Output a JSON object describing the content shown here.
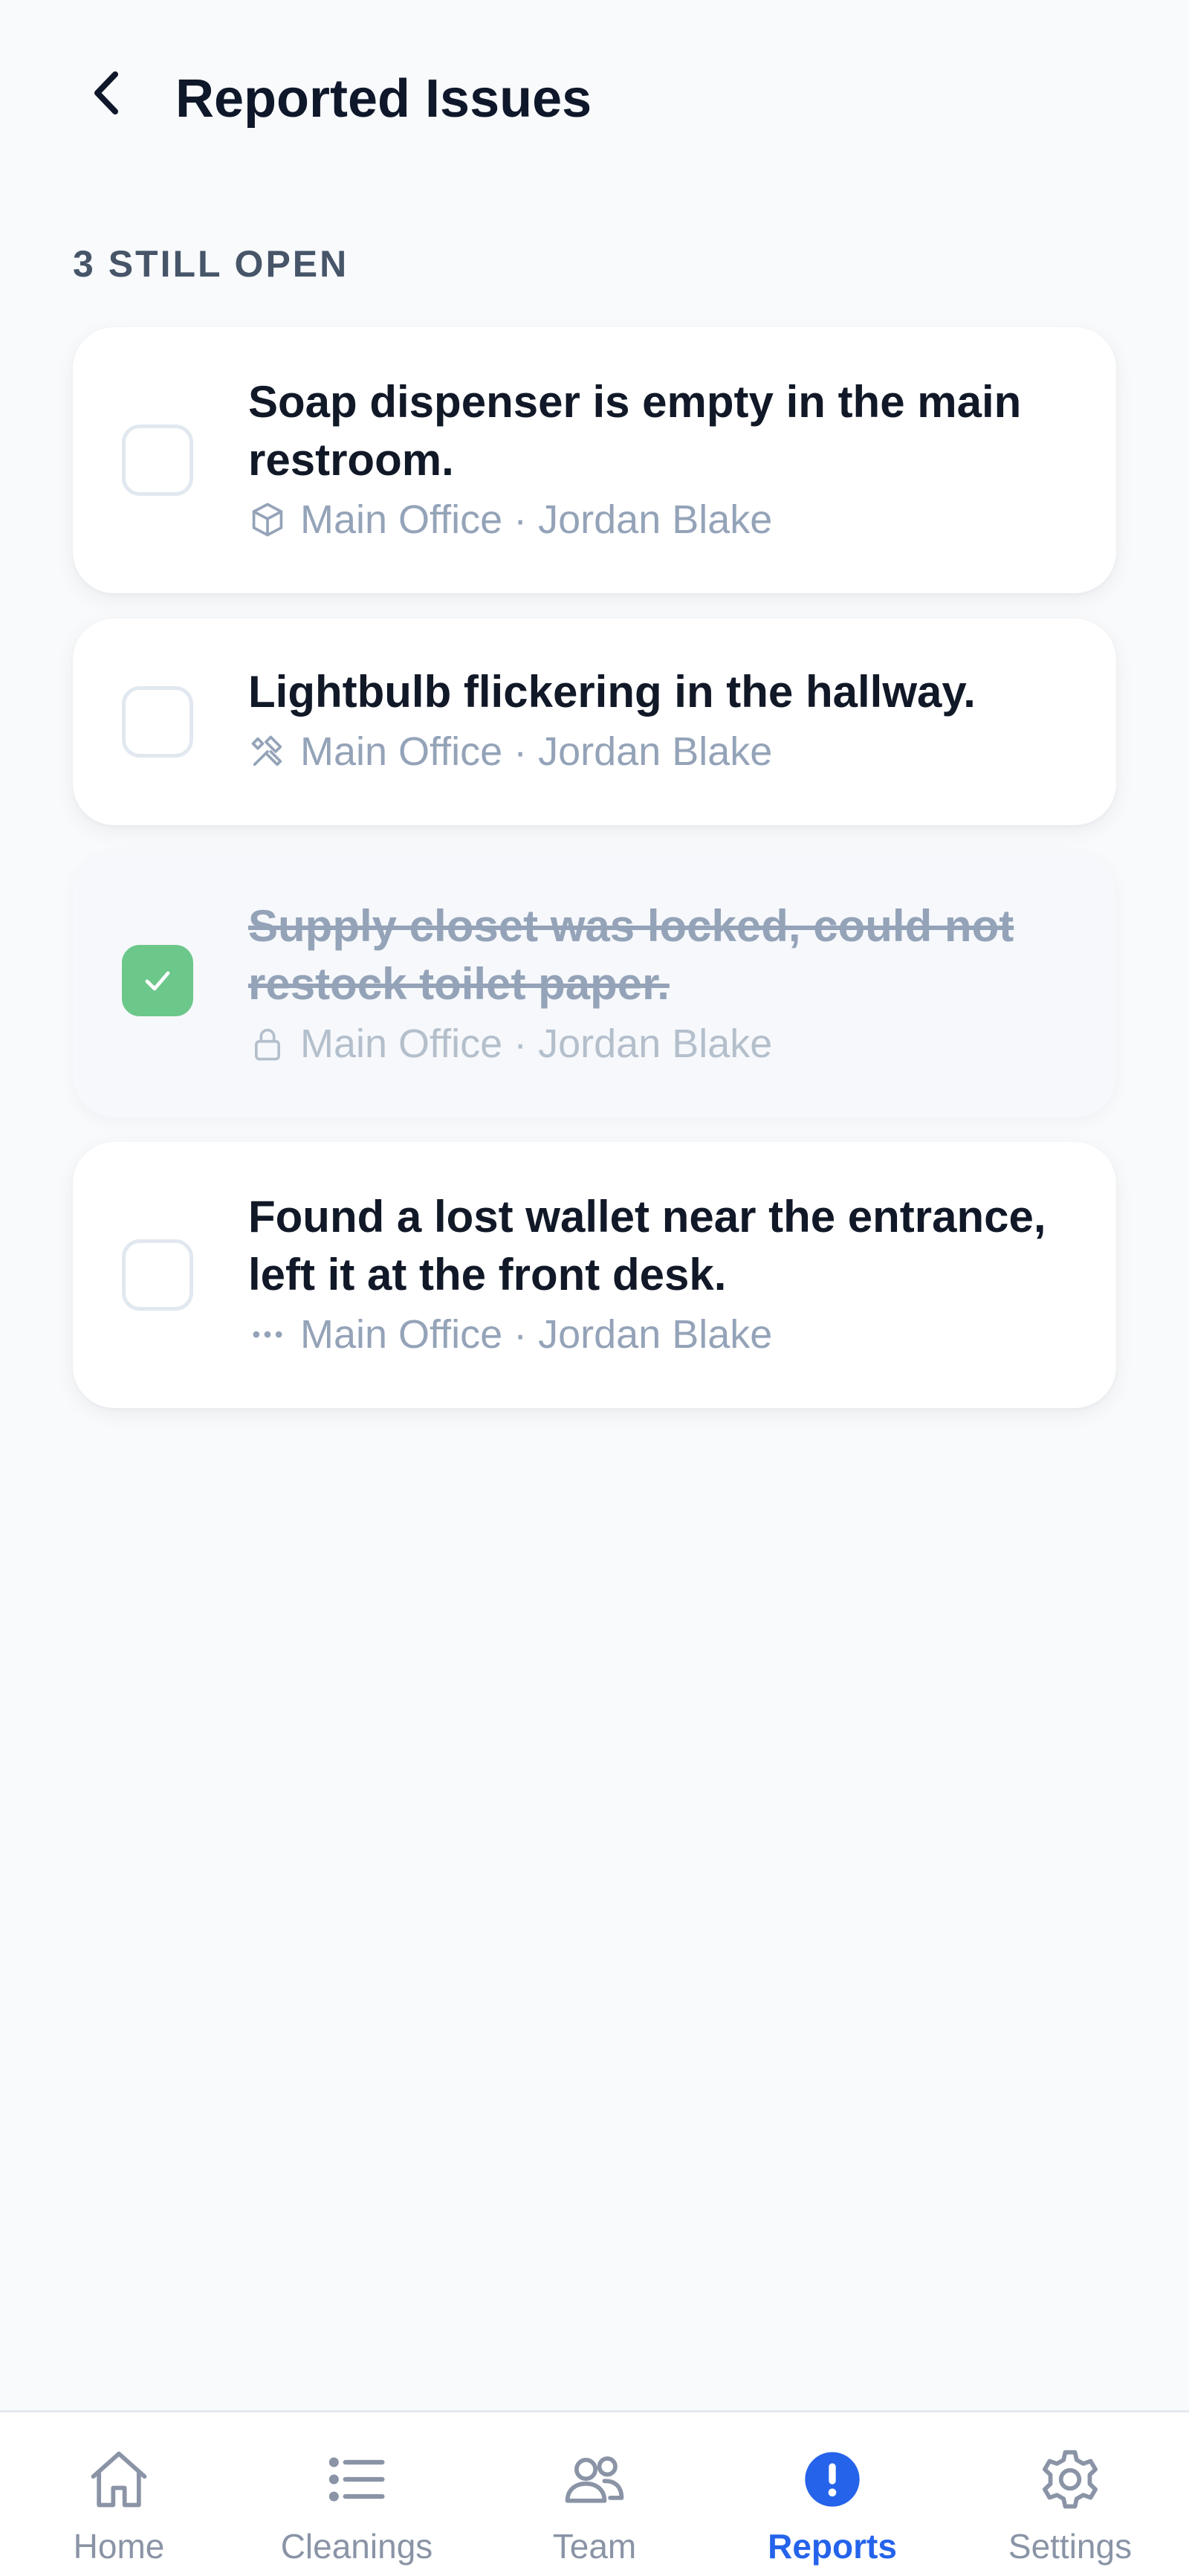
{
  "header": {
    "title": "Reported Issues"
  },
  "section": {
    "label": "3 Still Open"
  },
  "issues": [
    {
      "title": "Soap dispenser is empty in the main restroom.",
      "location": "Main Office",
      "reporter": "Jordan Blake",
      "separator": " · ",
      "category_icon": "box-icon",
      "resolved": false
    },
    {
      "title": "Lightbulb flickering in the hallway.",
      "location": "Main Office",
      "reporter": "Jordan Blake",
      "separator": " · ",
      "category_icon": "tools-icon",
      "resolved": false
    },
    {
      "title": "Supply closet was locked, could not restock toilet paper.",
      "location": "Main Office",
      "reporter": "Jordan Blake",
      "separator": " · ",
      "category_icon": "lock-icon",
      "resolved": true
    },
    {
      "title": "Found a lost wallet near the entrance, left it at the front desk.",
      "location": "Main Office",
      "reporter": "Jordan Blake",
      "separator": " · ",
      "category_icon": "more-dots-icon",
      "resolved": false
    }
  ],
  "tabs": [
    {
      "label": "Home",
      "icon": "home-icon",
      "active": false
    },
    {
      "label": "Cleanings",
      "icon": "list-icon",
      "active": false
    },
    {
      "label": "Team",
      "icon": "team-icon",
      "active": false
    },
    {
      "label": "Reports",
      "icon": "alert-icon",
      "active": true
    },
    {
      "label": "Settings",
      "icon": "gear-icon",
      "active": false
    }
  ],
  "colors": {
    "accent": "#2563eb",
    "success": "#6cc78a",
    "text_primary": "#0f172a",
    "text_muted": "#94a3b8",
    "background": "#f8fafc"
  }
}
